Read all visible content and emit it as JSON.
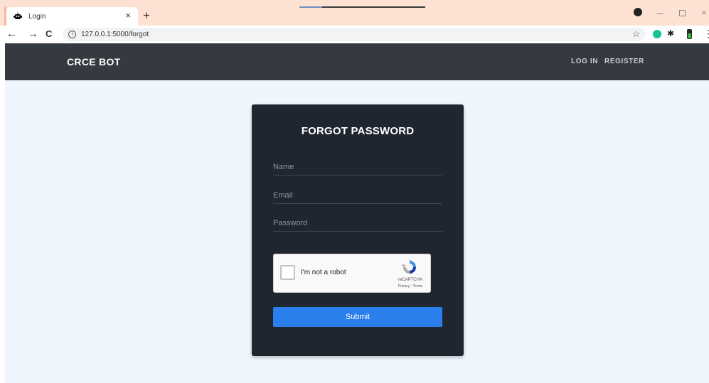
{
  "browser": {
    "tab_title": "Login",
    "tab_close": "×",
    "new_tab": "+",
    "url": "127.0.0.1:5000/forgot",
    "back": "←",
    "forward": "→",
    "reload": "C",
    "info": "i",
    "bookmark_star": "☆",
    "window_close": "×",
    "menu": "⋮"
  },
  "navbar": {
    "brand": "CRCE BOT",
    "links": [
      "LOG IN",
      "REGISTER"
    ]
  },
  "form": {
    "title": "FORGOT PASSWORD",
    "name_placeholder": "Name",
    "email_placeholder": "Email",
    "password_placeholder": "Password",
    "submit_label": "Submit"
  },
  "captcha": {
    "label": "I'm not a robot",
    "brand": "reCAPTCHA",
    "links": "Privacy - Terms"
  }
}
